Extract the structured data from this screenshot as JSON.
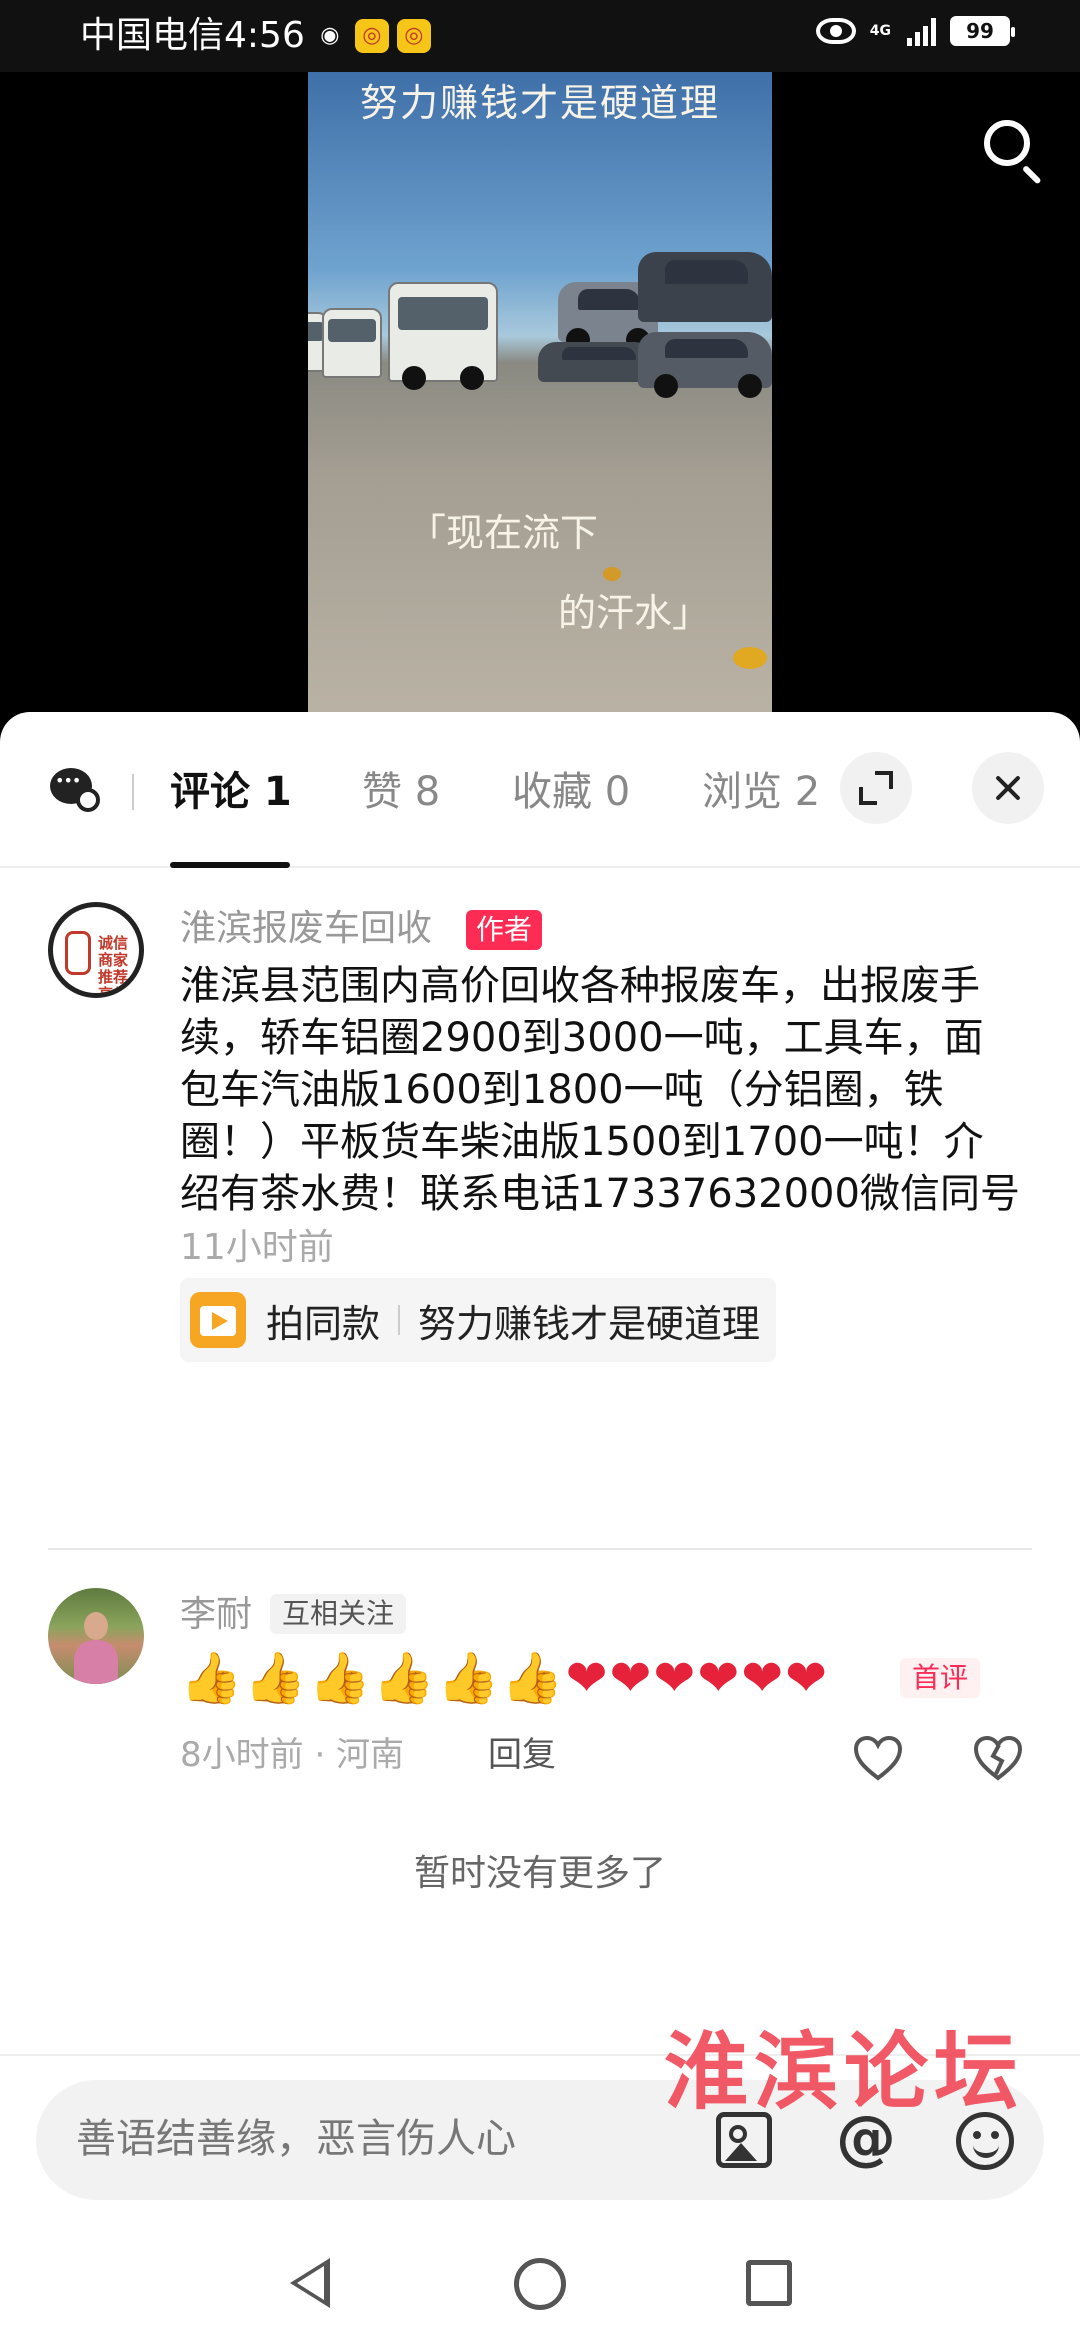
{
  "status_bar": {
    "carrier_time": "中国电信4:56",
    "network": "4G",
    "battery": "99"
  },
  "video": {
    "caption_top": "努力赚钱才是硬道理",
    "caption_line1": "「现在流下",
    "caption_line2": "的汗水」"
  },
  "tabs": [
    {
      "label": "评论 1",
      "active": true
    },
    {
      "label": "赞 8",
      "active": false
    },
    {
      "label": "收藏 0",
      "active": false
    },
    {
      "label": "浏览 2",
      "active": false
    }
  ],
  "comments": [
    {
      "name": "淮滨报废车回收",
      "badge": "作者",
      "avatar_text": "诚信商家 推荐 高价 回收",
      "text": "淮滨县范围内高价回收各种报废车，出报废手续，轿车铝圈2900到3000一吨，工具车，面包车汽油版1600到1800一吨（分铝圈，铁圈！）平板货车柴油版1500到1700一吨！介绍有茶水费！联系电话17337632000微信同号",
      "time": "11小时前",
      "template_label": "拍同款",
      "template_title": "努力赚钱才是硬道理"
    },
    {
      "name": "李耐",
      "badge": "互相关注",
      "emoji_thumbs": [
        "👍",
        "👍",
        "👍",
        "👍",
        "👍",
        "👍"
      ],
      "emoji_hearts": [
        "❤",
        "❤",
        "❤",
        "❤",
        "❤",
        "❤"
      ],
      "first_badge": "首评",
      "meta": "8小时前 · 河南",
      "reply": "回复"
    }
  ],
  "no_more": "暂时没有更多了",
  "input": {
    "placeholder": "善语结善缘，恶言伤人心",
    "at_symbol": "@"
  },
  "watermark": "淮滨论坛",
  "colors": {
    "accent": "#fe2c55",
    "template_icon": "#f6a623",
    "watermark": "#f04b5a"
  }
}
